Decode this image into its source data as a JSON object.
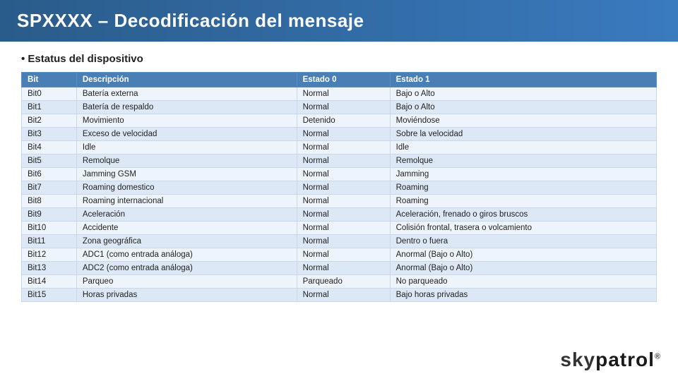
{
  "header": {
    "title": "SPXXXX – Decodificación del mensaje"
  },
  "section": {
    "label": "• Estatus del dispositivo"
  },
  "table": {
    "columns": [
      "Bit",
      "Descripción",
      "Estado 0",
      "Estado 1"
    ],
    "rows": [
      [
        "Bit0",
        "Batería externa",
        "Normal",
        "Bajo o Alto"
      ],
      [
        "Bit1",
        "Batería de respaldo",
        "Normal",
        "Bajo o Alto"
      ],
      [
        "Bit2",
        "Movimiento",
        "Detenido",
        "Moviéndose"
      ],
      [
        "Bit3",
        "Exceso de velocidad",
        "Normal",
        "Sobre la velocidad"
      ],
      [
        "Bit4",
        "Idle",
        "Normal",
        "Idle"
      ],
      [
        "Bit5",
        "Remolque",
        "Normal",
        "Remolque"
      ],
      [
        "Bit6",
        "Jamming GSM",
        "Normal",
        "Jamming"
      ],
      [
        "Bit7",
        "Roaming domestico",
        "Normal",
        "Roaming"
      ],
      [
        "Bit8",
        "Roaming internacional",
        "Normal",
        "Roaming"
      ],
      [
        "Bit9",
        "Aceleración",
        "Normal",
        "Aceleración, frenado o giros bruscos"
      ],
      [
        "Bit10",
        "Accidente",
        "Normal",
        "Colisión frontal, trasera o volcamiento"
      ],
      [
        "Bit11",
        "Zona geográfica",
        "Normal",
        "Dentro o fuera"
      ],
      [
        "Bit12",
        "ADC1 (como entrada análoga)",
        "Normal",
        "Anormal (Bajo o Alto)"
      ],
      [
        "Bit13",
        "ADC2 (como entrada análoga)",
        "Normal",
        "Anormal (Bajo o Alto)"
      ],
      [
        "Bit14",
        "Parqueo",
        "Parqueado",
        "No parqueado"
      ],
      [
        "Bit15",
        "Horas privadas",
        "Normal",
        "Bajo horas privadas"
      ]
    ]
  },
  "logo": {
    "sky": "sky",
    "patrol": "patrol",
    "reg": "®"
  }
}
